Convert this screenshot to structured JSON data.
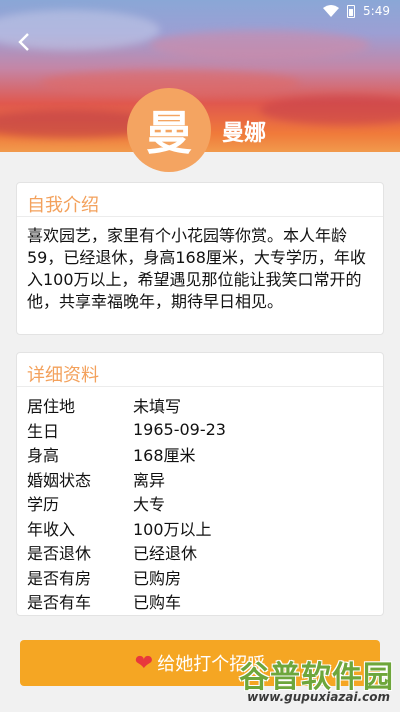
{
  "status_bar": {
    "time": "5:49"
  },
  "profile": {
    "avatar_char": "曼",
    "name": "曼娜"
  },
  "intro": {
    "title": "自我介绍",
    "text": "喜欢园艺，家里有个小花园等你赏。本人年龄59，已经退休，身高168厘米，大专学历，年收入100万以上，希望遇见那位能让我笑口常开的他，共享幸福晚年，期待早日相见。"
  },
  "details": {
    "title": "详细资料",
    "rows": [
      {
        "key": "居住地",
        "value": "未填写"
      },
      {
        "key": "生日",
        "value": "1965-09-23"
      },
      {
        "key": "身高",
        "value": "168厘米"
      },
      {
        "key": "婚姻状态",
        "value": "离异"
      },
      {
        "key": "学历",
        "value": "大专"
      },
      {
        "key": "年收入",
        "value": "100万以上"
      },
      {
        "key": "是否退休",
        "value": "已经退休"
      },
      {
        "key": "是否有房",
        "value": "已购房"
      },
      {
        "key": "是否有车",
        "value": "已购车"
      }
    ]
  },
  "cta": {
    "label": "给她打个招呼"
  },
  "watermark": {
    "main": "谷普软件园",
    "url": "www.gupuxiazai.com"
  },
  "colors": {
    "accent": "#f5a623",
    "title": "#f3a15c",
    "avatar": "#f4a461",
    "heart": "#e8383c"
  },
  "icons": {
    "back": "chevron-left-icon",
    "wifi": "wifi-icon",
    "battery": "battery-icon",
    "heart": "heart-icon"
  }
}
